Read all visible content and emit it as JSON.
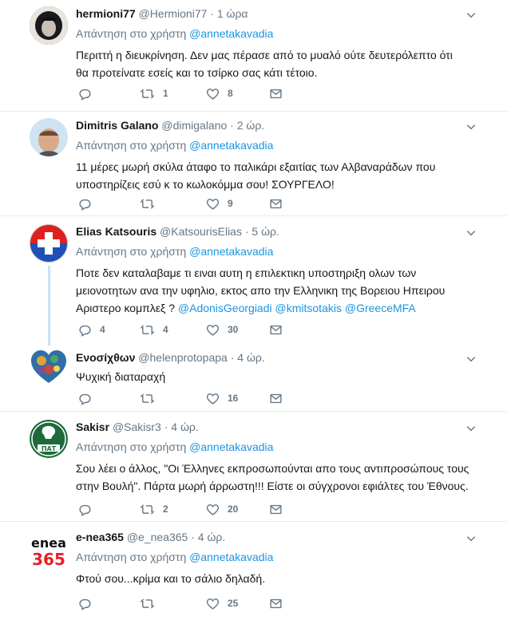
{
  "reply_prefix": "Απάντηση στο χρήστη",
  "tweets": [
    {
      "name": "hermioni77",
      "handle": "@Hermioni77",
      "time": "1 ώρα",
      "reply_to": "@annetakavadia",
      "lines": [
        "Περιττή η διευκρίνηση. Δεν μας πέρασε από το μυαλό ούτε δευτερόλεπτο ότι",
        "θα προτείνατε εσείς και το τσίρκο σας κάτι τέτοιο."
      ],
      "retweets": "1",
      "likes": "8"
    },
    {
      "name": "Dimitris Galano",
      "handle": "@dimigalano",
      "time": "2 ώρ.",
      "reply_to": "@annetakavadia",
      "lines": [
        "11 μέρες μωρή σκύλα άταφο το παλικάρι εξαιτίας των Αλβαναράδων που",
        "υποστηρίζεις εσύ κ το κωλοκόμμα σου! ΣΟΥΡΓΕΛΟ!"
      ],
      "retweets": "",
      "likes": "9"
    },
    {
      "name": "Elias Katsouris",
      "handle": "@KatsourisElias",
      "time": "5 ώρ.",
      "reply_to": "@annetakavadia",
      "lines": [
        "Ποτε δεν καταλαβαμε τι ειναι αυτη η επιλεκτικη υποστηριξη ολων των",
        "μειονοτητων ανα την υφηλιο, εκτος απο την Ελληνικη της Βορειου Ηπειρου"
      ],
      "last_line": "Αριστερο κομπλεξ ?",
      "mentions": [
        "@AdonisGeorgiadi",
        "@kmitsotakis",
        "@GreeceMFA"
      ],
      "replies": "4",
      "retweets": "4",
      "likes": "30"
    },
    {
      "name": "Ενοσίχθων",
      "handle": "@helenprotopapa",
      "time": "4 ώρ.",
      "lines": [
        "Ψυχική διαταραχή"
      ],
      "retweets": "",
      "likes": "16"
    },
    {
      "name": "Sakisr",
      "handle": "@Sakisr3",
      "time": "4 ώρ.",
      "reply_to": "@annetakavadia",
      "lines": [
        "Σου λέει ο άλλος, \"Οι Έλληνες εκπροσωπούνται απο τους αντιπροσώπους τους",
        "στην Βουλή\". Πάρτα μωρή άρρωστη!!! Είστε οι σύγχρονοι εφιάλτες του Έθνους."
      ],
      "retweets": "2",
      "likes": "20",
      "avatar_text": "ΠΑΤ"
    },
    {
      "name": "e-nea365",
      "handle": "@e_nea365",
      "time": "4 ώρ.",
      "reply_to": "@annetakavadia",
      "lines": [
        "Φτού σου...κρίμα και το σάλιο δηλαδή."
      ],
      "retweets": "",
      "likes": "25",
      "avatar_top": "enea",
      "avatar_bottom": "365"
    }
  ],
  "colors": {
    "link": "#1b95e0",
    "muted": "#657786",
    "text": "#14171a",
    "divider": "#e6ecf0"
  }
}
